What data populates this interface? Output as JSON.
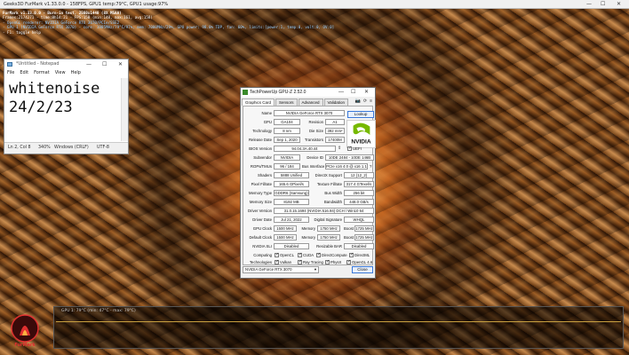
{
  "furmark": {
    "title": "Geeks3D FurMark v1.33.0.0 - 158FPS, GPU1 temp:79°C, GPU1 usage:97%",
    "window_controls": [
      "—",
      "☐",
      "✕"
    ],
    "overlay_lines": [
      "FurMark v1.33.0.0 - Burn-in test, 2560x1440 (8X MSAA)",
      "Frames:2174271 - time:8h14:21 - FPS:158 (min:148, max:161, avg:158)",
      "- OpenGL renderer: NVIDIA GeForce RTX 3070/PCIe/SSE2",
      "- GPU 1 (NVIDIA GeForce RTX 3070) - core: 1905MHz/79°C/97%, mem: 7000MHz/29%, GPU power: 98.0% TDP, fan: 60%, limits:[power:1, temp:0, volt:0, OV:0]",
      "- F1: toggle help"
    ],
    "graph_label": "GPU 1: 79°C (min: 47°C - max: 79°C)",
    "logo_text": "FurMark"
  },
  "notepad": {
    "title": "*Untitled - Notepad",
    "window_controls": [
      "—",
      "☐",
      "✕"
    ],
    "menu": [
      "File",
      "Edit",
      "Format",
      "View",
      "Help"
    ],
    "content_line1": "whitenoise",
    "content_line2": "24/2/23",
    "status": {
      "position": "Ln 2, Col 8",
      "zoom": "340%",
      "line_ending": "Windows (CRLF)",
      "encoding": "UTF-8"
    }
  },
  "gpuz": {
    "title": "TechPowerUp GPU-Z 2.52.0",
    "window_controls": [
      "—",
      "☐",
      "✕"
    ],
    "tabs": [
      "Graphics Card",
      "Sensors",
      "Advanced",
      "Validation"
    ],
    "toolbar_icons": [
      "camera-icon",
      "refresh-icon",
      "menu-icon"
    ],
    "lookup_label": "Lookup",
    "logo_text": "NVIDIA",
    "fields": {
      "name": {
        "label": "Name",
        "value": "NVIDIA GeForce RTX 3070"
      },
      "gpu": {
        "label": "GPU",
        "value": "GA104"
      },
      "revision": {
        "label": "Revision",
        "value": "A1"
      },
      "technology": {
        "label": "Technology",
        "value": "8 nm"
      },
      "die_size": {
        "label": "Die Size",
        "value": "392 mm²"
      },
      "release_date": {
        "label": "Release Date",
        "value": "Sep 1, 2020"
      },
      "transistors": {
        "label": "Transistors",
        "value": "17400M"
      },
      "bios_version": {
        "label": "BIOS Version",
        "value": "94.04.3A.40.44"
      },
      "uefi": {
        "label": "UEFI",
        "checked": true
      },
      "subvendor": {
        "label": "Subvendor",
        "value": "NVIDIA"
      },
      "device_id": {
        "label": "Device ID",
        "value": "10DE 2484 - 10DE 146B"
      },
      "rops_tmus": {
        "label": "ROPs/TMUs",
        "value": "96 / 184"
      },
      "bus_interface": {
        "label": "Bus Interface",
        "value": "PCIe x16 4.0 @ x16 1.1",
        "help": "?"
      },
      "shaders": {
        "label": "Shaders",
        "value": "5888 Unified"
      },
      "directx": {
        "label": "DirectX Support",
        "value": "12 (12_2)"
      },
      "pixel_fillrate": {
        "label": "Pixel Fillrate",
        "value": "165.6 GPixel/s"
      },
      "texture_fillrate": {
        "label": "Texture Fillrate",
        "value": "317.4 GTexel/s"
      },
      "memory_type": {
        "label": "Memory Type",
        "value": "GDDR6 (Samsung)"
      },
      "bus_width": {
        "label": "Bus Width",
        "value": "256 bit"
      },
      "memory_size": {
        "label": "Memory Size",
        "value": "8192 MB"
      },
      "bandwidth": {
        "label": "Bandwidth",
        "value": "448.0 GB/s"
      },
      "driver_version": {
        "label": "Driver Version",
        "value": "31.0.15.1694 (NVIDIA 516.94) DCH / Win10 64"
      },
      "driver_date": {
        "label": "Driver Date",
        "value": "Jul 21, 2022"
      },
      "digital_signature": {
        "label": "Digital Signature",
        "value": "WHQL"
      },
      "gpu_clock": {
        "label": "GPU Clock",
        "value": "1500 MHz"
      },
      "memory_clock": {
        "label": "Memory",
        "value": "1750 MHz"
      },
      "boost_clock": {
        "label": "Boost",
        "value": "1725 MHz"
      },
      "default_clock": {
        "label": "Default Clock",
        "value": "1500 MHz"
      },
      "default_memory": {
        "label": "Memory",
        "value": "1750 MHz"
      },
      "default_boost": {
        "label": "Boost",
        "value": "1725 MHz"
      },
      "nvidia_sli": {
        "label": "NVIDIA SLI",
        "value": "Disabled"
      },
      "resizable_bar": {
        "label": "Resizable BAR",
        "value": "Disabled"
      }
    },
    "computing": {
      "label": "Computing",
      "items": [
        {
          "name": "OpenCL",
          "checked": true
        },
        {
          "name": "CUDA",
          "checked": true
        },
        {
          "name": "DirectCompute",
          "checked": true
        },
        {
          "name": "DirectML",
          "checked": true
        }
      ]
    },
    "technologies": {
      "label": "Technologies",
      "items": [
        {
          "name": "Vulkan",
          "checked": true
        },
        {
          "name": "Ray Tracing",
          "checked": true
        },
        {
          "name": "PhysX",
          "checked": true
        },
        {
          "name": "OpenGL 4.6",
          "checked": true
        }
      ]
    },
    "selected_card": "NVIDIA GeForce RTX 3070",
    "close_label": "Close"
  },
  "colors": {
    "nvidia_green": "#76b900",
    "accent_blue": "#3a78d8",
    "furmark_red": "#e03030"
  }
}
